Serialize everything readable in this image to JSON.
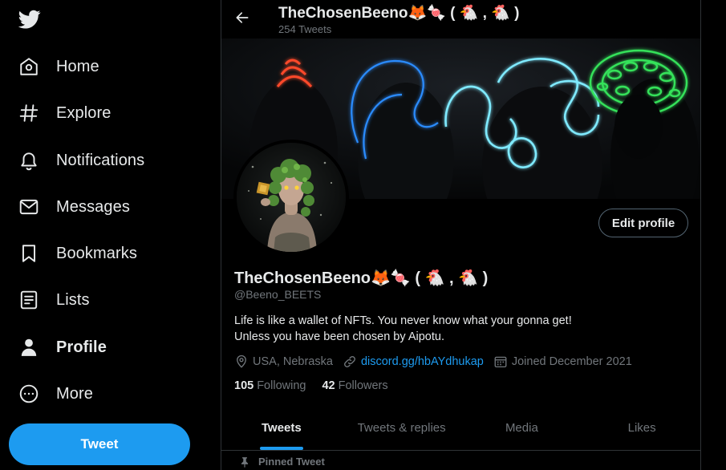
{
  "sidebar": {
    "logo_icon": "twitter-bird-icon",
    "items": [
      {
        "label": "Home",
        "icon": "home-icon"
      },
      {
        "label": "Explore",
        "icon": "hashtag-icon"
      },
      {
        "label": "Notifications",
        "icon": "bell-icon"
      },
      {
        "label": "Messages",
        "icon": "envelope-icon"
      },
      {
        "label": "Bookmarks",
        "icon": "bookmark-icon"
      },
      {
        "label": "Lists",
        "icon": "list-icon"
      },
      {
        "label": "Profile",
        "icon": "person-icon",
        "active": true
      },
      {
        "label": "More",
        "icon": "more-circle-icon"
      }
    ],
    "tweet_button": "Tweet"
  },
  "header": {
    "name": "TheChosenBeeno🦊🍬 ( 🐔 , 🐔 )",
    "tweet_count": "254 Tweets"
  },
  "profile": {
    "display_name": "TheChosenBeeno🦊🍬 ( 🐔 , 🐔 )",
    "handle": "@Beeno_BEETS",
    "edit_button": "Edit profile",
    "bio_lines": [
      "Life is like a wallet of NFTs. You never know what your gonna get!",
      "Unless you have been chosen by Aipotu."
    ],
    "location": "USA, Nebraska",
    "link": "discord.gg/hbAYdhukap",
    "joined": "Joined December 2021",
    "following_count": "105",
    "following_label": "Following",
    "followers_count": "42",
    "followers_label": "Followers"
  },
  "tabs": [
    {
      "label": "Tweets",
      "active": true
    },
    {
      "label": "Tweets & replies"
    },
    {
      "label": "Media"
    },
    {
      "label": "Likes"
    }
  ],
  "pinned_label": "Pinned Tweet",
  "colors": {
    "accent": "#1d9bf0",
    "background": "#000000",
    "text_primary": "#e7e9ea",
    "text_secondary": "#71767b",
    "border": "#2f3336"
  }
}
